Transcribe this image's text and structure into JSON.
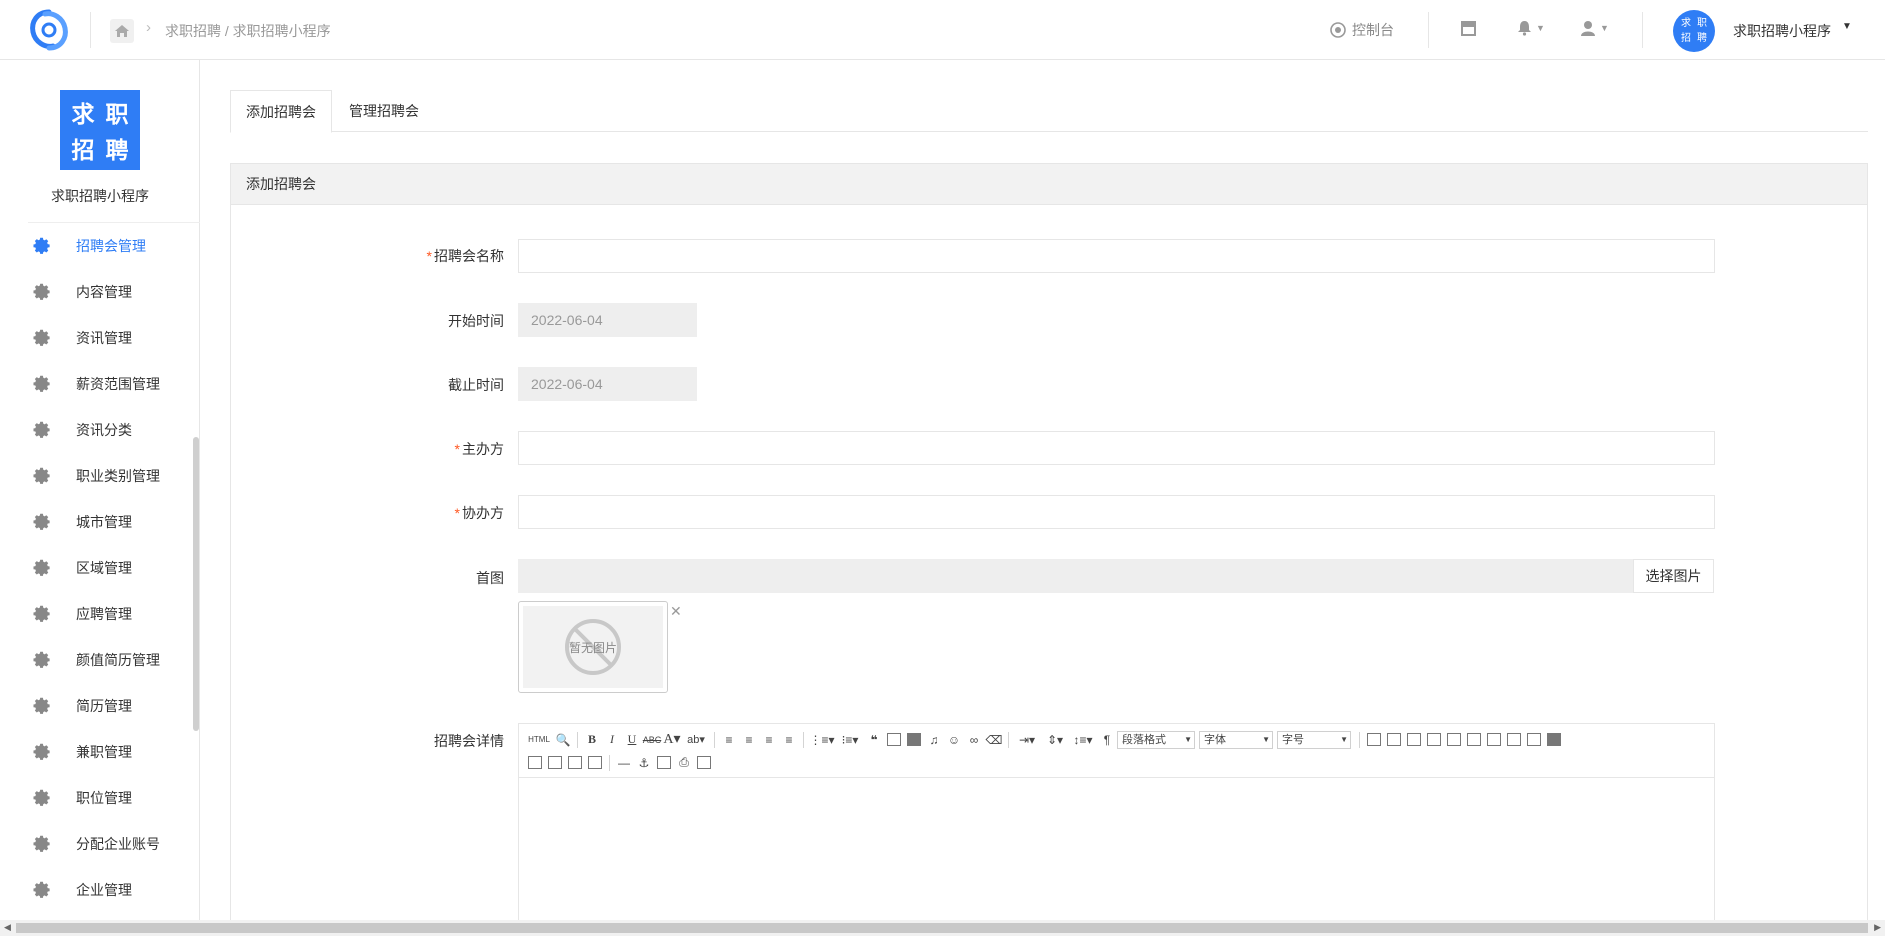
{
  "header": {
    "breadcrumb": "求职招聘 / 求职招聘小程序",
    "console_label": "控制台",
    "avatar_text": [
      "求",
      "职",
      "招",
      "聘"
    ],
    "user_name": "求职招聘小程序"
  },
  "sidebar": {
    "brand_chars": [
      "求",
      "职",
      "招",
      "聘"
    ],
    "brand_name": "求职招聘小程序",
    "items": [
      {
        "label": "招聘会管理",
        "active": true
      },
      {
        "label": "内容管理"
      },
      {
        "label": "资讯管理"
      },
      {
        "label": "薪资范围管理"
      },
      {
        "label": "资讯分类"
      },
      {
        "label": "职业类别管理"
      },
      {
        "label": "城市管理"
      },
      {
        "label": "区域管理"
      },
      {
        "label": "应聘管理"
      },
      {
        "label": "颜值简历管理"
      },
      {
        "label": "简历管理"
      },
      {
        "label": "兼职管理"
      },
      {
        "label": "职位管理"
      },
      {
        "label": "分配企业账号"
      },
      {
        "label": "企业管理"
      }
    ]
  },
  "tabs": [
    {
      "label": "添加招聘会",
      "active": true
    },
    {
      "label": "管理招聘会"
    }
  ],
  "panel_title": "添加招聘会",
  "form": {
    "name_label": "招聘会名称",
    "start_label": "开始时间",
    "start_value": "2022-06-04",
    "end_label": "截止时间",
    "end_value": "2022-06-04",
    "host_label": "主办方",
    "co_label": "协办方",
    "image_label": "首图",
    "pick_image": "选择图片",
    "no_image": "暂无图片",
    "detail_label": "招聘会详情"
  },
  "editor": {
    "html_label": "HTML",
    "para_format": "段落格式",
    "font_family": "字体",
    "font_size": "字号"
  },
  "colors": {
    "accent": "#2f7df5",
    "required": "#ff5722"
  }
}
